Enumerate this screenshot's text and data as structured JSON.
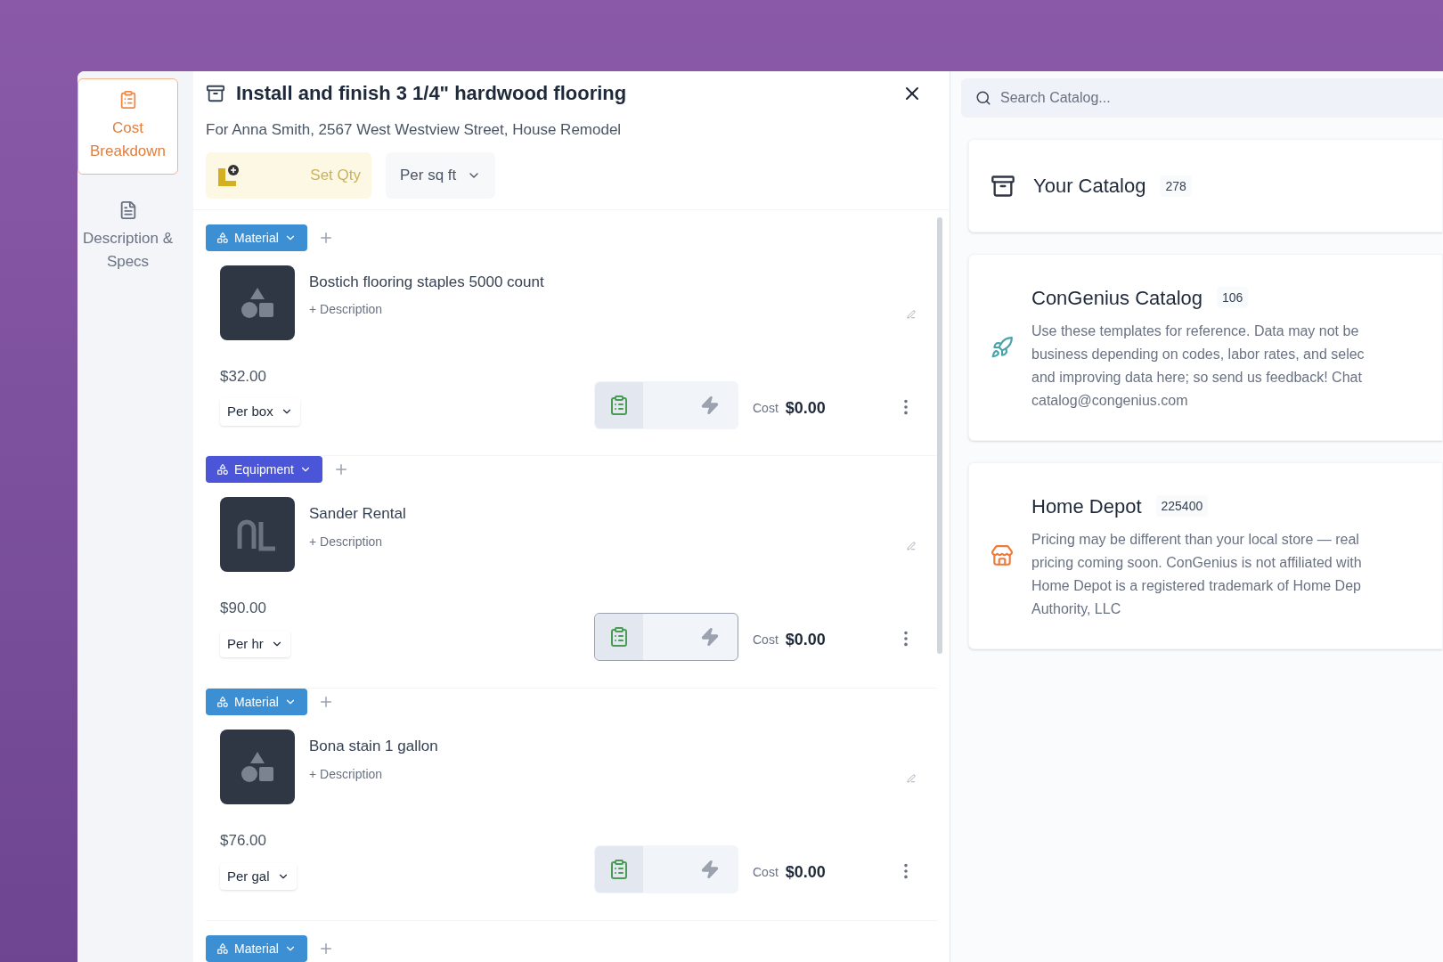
{
  "sidebar": {
    "items": [
      {
        "label": "Cost Breakdown",
        "kind": "cost",
        "selected": true
      },
      {
        "label": "Description & Specs",
        "kind": "specs",
        "selected": false
      }
    ]
  },
  "header": {
    "title": "Install and finish 3 1/4\" hardwood flooring",
    "subtitle": "For Anna Smith, 2567 West Westview Street, House Remodel",
    "set_qty": "Set Qty",
    "unit": "Per sq ft"
  },
  "items": [
    {
      "tag": {
        "label": "Material",
        "kind": "material"
      },
      "name": "Bostich flooring staples 5000 count",
      "description_placeholder": "+ Description",
      "price": "$32.00",
      "unit": "Per box",
      "cost_label": "Cost",
      "cost": "$0.00",
      "focused": false
    },
    {
      "tag": {
        "label": "Equipment",
        "kind": "equipment"
      },
      "name": "Sander Rental",
      "description_placeholder": "+ Description",
      "price": "$90.00",
      "unit": "Per hr",
      "cost_label": "Cost",
      "cost": "$0.00",
      "focused": true
    },
    {
      "tag": {
        "label": "Material",
        "kind": "material"
      },
      "name": "Bona stain 1 gallon",
      "description_placeholder": "+ Description",
      "price": "$76.00",
      "unit": "Per gal",
      "cost_label": "Cost",
      "cost": "$0.00",
      "focused": false
    }
  ],
  "trailing_tag": {
    "label": "Material",
    "kind": "material"
  },
  "catalog": {
    "search": {
      "placeholder": "Search Catalog..."
    },
    "sources": [
      {
        "kind": "own",
        "name": "Your Catalog",
        "count": "278"
      },
      {
        "kind": "congenius",
        "name": "ConGenius Catalog",
        "count": "106",
        "description_lines": [
          "Use these templates for reference. Data may not be",
          "business depending on codes, labor rates, and selec",
          "and improving data here; so send us feedback! Chat",
          "catalog@congenius.com"
        ]
      },
      {
        "kind": "store",
        "name": "Home Depot",
        "count": "225400",
        "description_lines": [
          "Pricing may be different than your local store — real",
          "pricing coming soon. ConGenius is not affiliated with",
          "Home Depot is a registered trademark of Home Dep",
          "Authority, LLC"
        ]
      }
    ]
  }
}
